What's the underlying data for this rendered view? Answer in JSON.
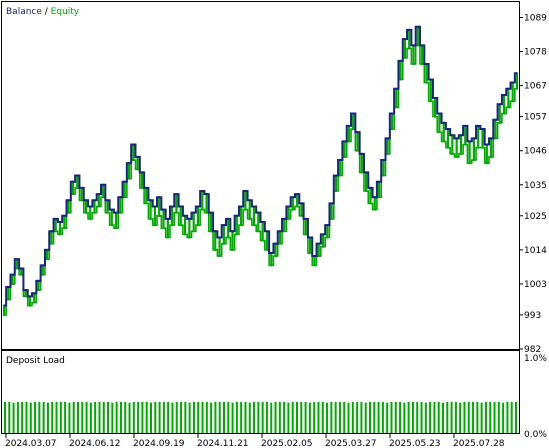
{
  "legend": {
    "balance": "Balance",
    "separator": " / ",
    "equity": "Equity"
  },
  "colors": {
    "balance": "#1a237e",
    "equity": "#00aa00",
    "deposit_load": "#00aa00",
    "frame": "#000000",
    "grid": "#ffffff"
  },
  "subchart": {
    "title": "Deposit Load",
    "y_top_label": "1.0%",
    "y_bottom_label": "0.0%"
  },
  "chart_data": [
    {
      "type": "line",
      "series": [
        {
          "name": "Balance",
          "values": [
            996,
            1002,
            1006,
            1011,
            1008,
            1001,
            999,
            1000,
            1004,
            1009,
            1014,
            1020,
            1024,
            1023,
            1025,
            1030,
            1036,
            1038,
            1034,
            1030,
            1028,
            1030,
            1032,
            1035,
            1030,
            1027,
            1026,
            1031,
            1036,
            1042,
            1048,
            1044,
            1039,
            1034,
            1030,
            1028,
            1031,
            1027,
            1024,
            1028,
            1032,
            1028,
            1025,
            1024,
            1026,
            1028,
            1033,
            1032,
            1026,
            1020,
            1018,
            1022,
            1024,
            1020,
            1025,
            1028,
            1033,
            1030,
            1028,
            1026,
            1023,
            1020,
            1013,
            1016,
            1020,
            1024,
            1028,
            1031,
            1032,
            1029,
            1024,
            1018,
            1012,
            1016,
            1019,
            1022,
            1029,
            1038,
            1043,
            1049,
            1054,
            1058,
            1052,
            1045,
            1039,
            1034,
            1031,
            1036,
            1043,
            1050,
            1058,
            1066,
            1075,
            1082,
            1085,
            1080,
            1086,
            1080,
            1074,
            1069,
            1063,
            1058,
            1055,
            1053,
            1051,
            1050,
            1051,
            1054,
            1049,
            1050,
            1054,
            1053,
            1048,
            1050,
            1056,
            1061,
            1064,
            1066,
            1068,
            1071
          ]
        },
        {
          "name": "Equity",
          "values": [
            993,
            998,
            1003,
            1008,
            1006,
            999,
            996,
            997,
            1001,
            1006,
            1011,
            1016,
            1020,
            1019,
            1021,
            1026,
            1032,
            1034,
            1030,
            1026,
            1024,
            1026,
            1028,
            1031,
            1026,
            1022,
            1021,
            1026,
            1031,
            1037,
            1043,
            1040,
            1034,
            1029,
            1024,
            1022,
            1025,
            1021,
            1018,
            1022,
            1026,
            1022,
            1019,
            1018,
            1020,
            1022,
            1027,
            1026,
            1020,
            1014,
            1012,
            1016,
            1018,
            1014,
            1019,
            1022,
            1027,
            1024,
            1022,
            1020,
            1017,
            1014,
            1009,
            1012,
            1016,
            1020,
            1024,
            1027,
            1028,
            1025,
            1019,
            1013,
            1009,
            1012,
            1015,
            1018,
            1024,
            1033,
            1038,
            1044,
            1049,
            1053,
            1046,
            1039,
            1033,
            1029,
            1027,
            1031,
            1038,
            1045,
            1053,
            1060,
            1069,
            1076,
            1079,
            1074,
            1080,
            1074,
            1068,
            1062,
            1057,
            1052,
            1049,
            1047,
            1045,
            1044,
            1045,
            1048,
            1042,
            1043,
            1047,
            1047,
            1042,
            1044,
            1050,
            1055,
            1058,
            1060,
            1062,
            1066
          ]
        }
      ],
      "y_ticks": [
        "1089",
        "1078",
        "1067",
        "1057",
        "1046",
        "1035",
        "1025",
        "1014",
        "1003",
        "993",
        "982"
      ],
      "ylim": [
        982,
        1094
      ],
      "x_ticks": [
        "2024.03.07",
        "2024.06.12",
        "2024.09.19",
        "2024.11.21",
        "2025.02.05",
        "2025.03.27",
        "2025.05.23",
        "2025.07.28"
      ],
      "grid": false
    },
    {
      "type": "bar",
      "title": "Deposit Load",
      "y_ticks": [
        "1.0%",
        "0.0%"
      ],
      "ylim": [
        0,
        1.0
      ],
      "values": [
        0.38,
        0.38,
        0.37,
        0.38,
        0.38,
        0.38,
        0.37,
        0.38,
        0.38,
        0.38,
        0.37,
        0.38,
        0.38,
        0.38,
        0.38,
        0.37,
        0.38,
        0.38,
        0.38,
        0.38,
        0.37,
        0.38,
        0.38,
        0.38,
        0.38,
        0.37,
        0.38,
        0.38,
        0.38,
        0.37,
        0.38,
        0.38,
        0.38,
        0.38,
        0.37,
        0.38,
        0.38,
        0.38,
        0.38,
        0.37,
        0.38,
        0.38,
        0.38,
        0.37,
        0.38,
        0.38,
        0.38,
        0.38,
        0.37,
        0.38,
        0.38,
        0.38,
        0.38,
        0.37,
        0.38,
        0.38,
        0.38,
        0.37,
        0.38,
        0.38,
        0.38,
        0.38,
        0.37,
        0.38,
        0.38,
        0.38,
        0.37,
        0.38,
        0.38,
        0.38,
        0.38,
        0.37,
        0.38,
        0.38,
        0.38,
        0.37,
        0.38,
        0.38,
        0.38,
        0.38,
        0.37,
        0.38,
        0.38,
        0.38,
        0.37,
        0.38,
        0.38,
        0.38,
        0.38,
        0.37,
        0.38,
        0.38,
        0.38,
        0.37,
        0.38,
        0.38,
        0.38,
        0.38,
        0.37,
        0.38,
        0.38,
        0.38,
        0.37,
        0.38,
        0.38,
        0.38,
        0.37,
        0.38,
        0.38,
        0.38,
        0.38,
        0.37,
        0.38,
        0.38,
        0.38,
        0.38,
        0.37,
        0.38,
        0.38,
        0.38
      ]
    }
  ]
}
